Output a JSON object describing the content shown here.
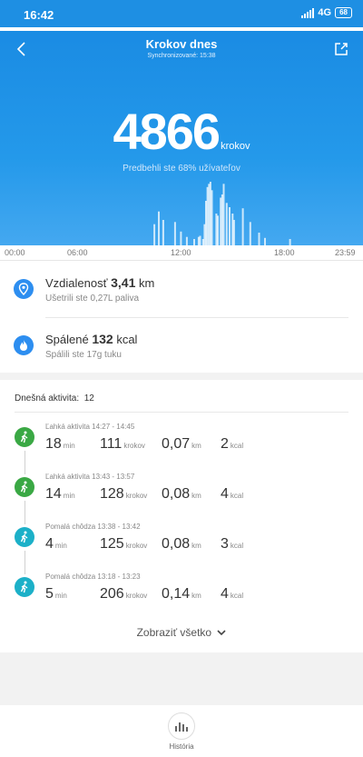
{
  "status": {
    "time": "16:42",
    "network": "4G",
    "battery": "68"
  },
  "header": {
    "title": "Krokov dnes",
    "subtitle": "Synchronizované: 15:38",
    "steps": "4866",
    "steps_unit": "krokov",
    "comparison": "Predbehli ste 68% užívateľov"
  },
  "axis": {
    "ticks": [
      "00:00",
      "06:00",
      "12:00",
      "18:00",
      "23:59"
    ]
  },
  "chart_data": {
    "type": "bar",
    "xlabel": "",
    "ylabel": "",
    "x_range_hours": [
      0,
      24
    ],
    "x": [
      10.1,
      10.4,
      10.7,
      11.5,
      11.9,
      12.3,
      12.8,
      13.1,
      13.2,
      13.4,
      13.5,
      13.6,
      13.7,
      13.8,
      13.9,
      14.0,
      14.3,
      14.4,
      14.6,
      14.7,
      14.8,
      15.0,
      15.2,
      15.4,
      15.5,
      16.1,
      16.6,
      17.2,
      17.6,
      19.3
    ],
    "y": [
      20,
      32,
      24,
      22,
      13,
      8,
      6,
      8,
      9,
      6,
      20,
      42,
      55,
      58,
      60,
      52,
      30,
      28,
      45,
      48,
      58,
      40,
      36,
      30,
      24,
      35,
      22,
      12,
      7,
      6
    ]
  },
  "metrics": {
    "distance": {
      "label": "Vzdialenosť",
      "value": "3,41",
      "unit": "km",
      "sub": "Ušetrili ste 0,27L paliva"
    },
    "calories": {
      "label": "Spálené",
      "value": "132",
      "unit": "kcal",
      "sub": "Spálili ste 17g tuku"
    }
  },
  "activity": {
    "header": "Dnešná aktivita:",
    "count": "12",
    "items": [
      {
        "label": "Ľahká aktivita 14:27 - 14:45",
        "icon": "runner-icon",
        "color": "#3aa844",
        "min": "18",
        "steps": "111",
        "km": "0,07",
        "kcal": "2"
      },
      {
        "label": "Ľahká aktivita 13:43 - 13:57",
        "icon": "runner-icon",
        "color": "#3aa844",
        "min": "14",
        "steps": "128",
        "km": "0,08",
        "kcal": "4"
      },
      {
        "label": "Pomalá chôdza 13:38 - 13:42",
        "icon": "walker-icon",
        "color": "#1cb0c8",
        "min": "4",
        "steps": "125",
        "km": "0,08",
        "kcal": "3"
      },
      {
        "label": "Pomalá chôdza 13:18 - 13:23",
        "icon": "walker-icon",
        "color": "#1cb0c8",
        "min": "5",
        "steps": "206",
        "km": "0,14",
        "kcal": "4"
      }
    ],
    "units": {
      "min": "min",
      "steps": "krokov",
      "km": "km",
      "kcal": "kcal"
    },
    "show_all": "Zobraziť všetko"
  },
  "footer": {
    "history": "História"
  },
  "colors": {
    "accent": "#1e8fe3",
    "light_activity": "#3aa844",
    "slow_walk": "#1cb0c8"
  }
}
